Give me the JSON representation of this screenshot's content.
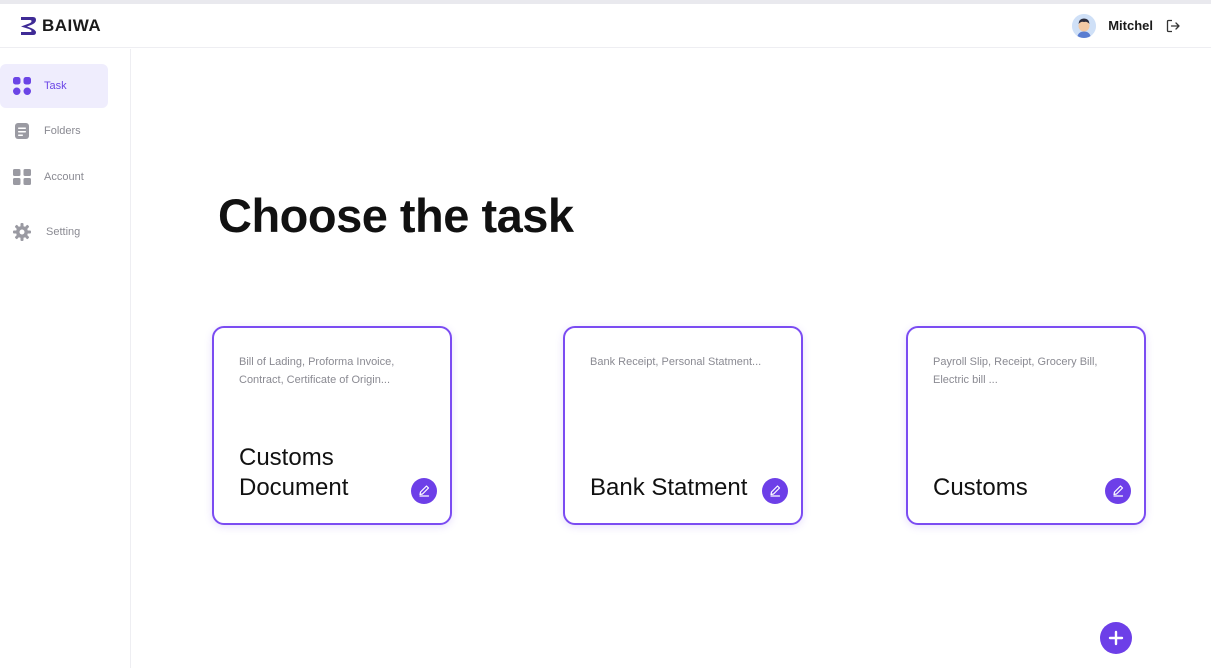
{
  "brand": {
    "name": "BAIWA",
    "logo_icon": "brand-b-logo"
  },
  "user": {
    "name": "Mitchel",
    "avatar_icon": "user-avatar",
    "logout_icon": "logout-icon"
  },
  "sidebar": {
    "items": [
      {
        "label": "Task",
        "icon": "grid-icon",
        "active": true
      },
      {
        "label": "Folders",
        "icon": "folder-icon",
        "active": false
      },
      {
        "label": "Account",
        "icon": "account-icon",
        "active": false
      },
      {
        "label": "Setting",
        "icon": "gear-icon",
        "active": false
      }
    ]
  },
  "main": {
    "title": "Choose the task",
    "cards": [
      {
        "desc": "Bill of Lading, Proforma Invoice, Contract, Certificate of Origin...",
        "title": "Customs Document",
        "edit_icon": "pencil-icon"
      },
      {
        "desc": "Bank Receipt, Personal Statment...",
        "title": "Bank Statment",
        "edit_icon": "pencil-icon"
      },
      {
        "desc": "Payroll Slip, Receipt, Grocery Bill, Electric bill ...",
        "title": "Customs",
        "edit_icon": "pencil-icon"
      }
    ],
    "fab_icon": "plus-icon"
  },
  "colors": {
    "accent": "#6d3fe8",
    "card_border": "#7b4cf2",
    "active_nav_bg": "#efedfd",
    "muted_text": "#8a8a92"
  }
}
